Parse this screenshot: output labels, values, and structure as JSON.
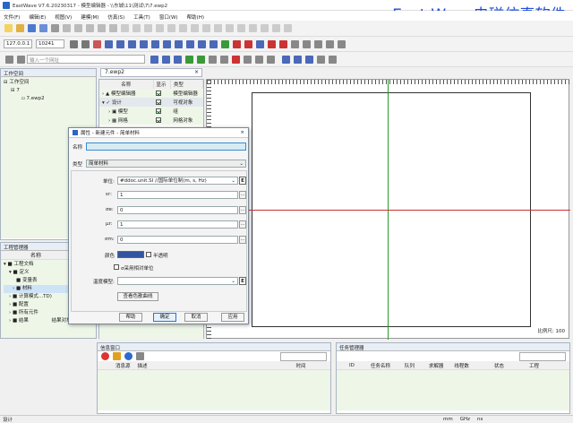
{
  "window": {
    "title": "EastWave V7.6.20230317 - 模型编辑器 - \\\\东城\\11\\测试\\7\\7.ewp2"
  },
  "brand_overlay": "East Wave电磁仿真软件",
  "menu": [
    "文件(F)",
    "编辑(E)",
    "视图(V)",
    "建模(M)",
    "仿真(S)",
    "工具(T)",
    "窗口(W)",
    "帮助(H)"
  ],
  "toolbar2": {
    "ip": "127.0.0.1",
    "port": "10241"
  },
  "toolbar3": {
    "search_placeholder": "输入一个网址"
  },
  "workspace": {
    "header": "工作空间",
    "tree": [
      "工作空间",
      "7",
      "7.ewp2"
    ]
  },
  "project_manager": {
    "header": "工程管理器",
    "columns": [
      "名称",
      "文"
    ],
    "tree": [
      "工程文档",
      "定义",
      "变量表",
      "材料",
      "计算模式...TD)",
      "配置",
      "所有元件",
      "结果"
    ],
    "extra": [
      "文",
      "类",
      "结果对象"
    ]
  },
  "editor_tab": {
    "label": "7.ewp2"
  },
  "model_tree": {
    "columns": [
      "名称",
      "显示",
      "类型"
    ],
    "rows": [
      {
        "name": "模型编辑器",
        "type": "模型编辑器"
      },
      {
        "name": "设计",
        "type": "可视对象"
      },
      {
        "name": "模型",
        "type": "组"
      },
      {
        "name": "网格",
        "type": "网格对象"
      }
    ]
  },
  "canvas": {
    "scale": "比例尺: 100"
  },
  "dialog": {
    "title": "属性 - 新建元件 - 简单材料",
    "name_label": "名称",
    "name_value": "",
    "type_label": "类型",
    "type_value": "简单材料",
    "unit_label": "单位:",
    "unit_value": "#ddoc.unit.SI //国际单位制(m, s, Hz)",
    "e_btn": "E",
    "eps_label": "εr:",
    "eps_value": "1",
    "sigma_e_label": "σe:",
    "sigma_e_value": "0",
    "mu_label": "μr:",
    "mu_value": "1",
    "sigma_m_label": "σm:",
    "sigma_m_value": "0",
    "color_label": "颜色",
    "color_value": "#3355a0",
    "semitrans_label": "半透明",
    "relative_unit_label": "σ采用相对单位",
    "temp_label": "温度模型:",
    "temp_value": "",
    "param_curve_btn": "查看色散曲线",
    "buttons": {
      "help": "帮助",
      "ok": "确定",
      "cancel": "取消",
      "apply": "应用"
    }
  },
  "info_panel": {
    "header": "信息窗口",
    "columns": [
      "消息源",
      "描述",
      "时间"
    ]
  },
  "task_panel": {
    "header": "任务管理器",
    "columns": [
      "ID",
      "任务名称",
      "队列",
      "求解器",
      "线程数",
      "状态",
      "工程"
    ]
  },
  "statusbar": {
    "left": "设计",
    "unit": "mm",
    "freq": "GHz",
    "time": "ns"
  }
}
